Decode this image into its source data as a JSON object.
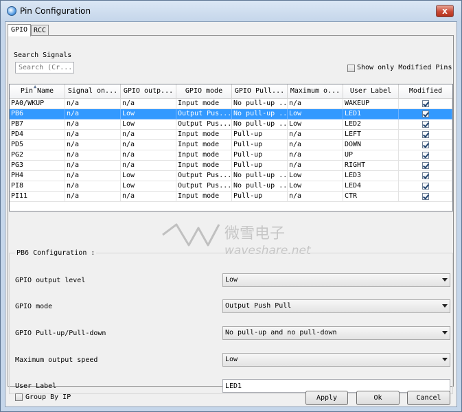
{
  "window": {
    "title": "Pin Configuration",
    "close_label": "x"
  },
  "tabs": [
    {
      "label": "GPIO",
      "active": true
    },
    {
      "label": "RCC",
      "active": false
    }
  ],
  "search": {
    "label": "Search Signals",
    "placeholder": "Search (Cr..."
  },
  "show_modified": {
    "label": "Show only Modified Pins",
    "checked": false
  },
  "table": {
    "columns": [
      "Pin Name",
      "Signal on...",
      "GPIO outp...",
      "GPIO mode",
      "GPIO Pull...",
      "Maximum o...",
      "User Label",
      "Modified"
    ],
    "rows": [
      {
        "cells": [
          "PA0/WKUP",
          "n/a",
          "n/a",
          "Input mode",
          "No pull-up ...",
          "n/a",
          "WAKEUP"
        ],
        "modified": true,
        "selected": false
      },
      {
        "cells": [
          "PB6",
          "n/a",
          "Low",
          "Output Pus...",
          "No pull-up ...",
          "Low",
          "LED1"
        ],
        "modified": true,
        "selected": true
      },
      {
        "cells": [
          "PB7",
          "n/a",
          "Low",
          "Output Pus...",
          "No pull-up ...",
          "Low",
          "LED2"
        ],
        "modified": true,
        "selected": false
      },
      {
        "cells": [
          "PD4",
          "n/a",
          "n/a",
          "Input mode",
          "Pull-up",
          "n/a",
          "LEFT"
        ],
        "modified": true,
        "selected": false
      },
      {
        "cells": [
          "PD5",
          "n/a",
          "n/a",
          "Input mode",
          "Pull-up",
          "n/a",
          "DOWN"
        ],
        "modified": true,
        "selected": false
      },
      {
        "cells": [
          "PG2",
          "n/a",
          "n/a",
          "Input mode",
          "Pull-up",
          "n/a",
          "UP"
        ],
        "modified": true,
        "selected": false
      },
      {
        "cells": [
          "PG3",
          "n/a",
          "n/a",
          "Input mode",
          "Pull-up",
          "n/a",
          "RIGHT"
        ],
        "modified": true,
        "selected": false
      },
      {
        "cells": [
          "PH4",
          "n/a",
          "Low",
          "Output Pus...",
          "No pull-up ...",
          "Low",
          "LED3"
        ],
        "modified": true,
        "selected": false
      },
      {
        "cells": [
          "PI8",
          "n/a",
          "Low",
          "Output Pus...",
          "No pull-up ...",
          "Low",
          "LED4"
        ],
        "modified": true,
        "selected": false
      },
      {
        "cells": [
          "PI11",
          "n/a",
          "n/a",
          "Input mode",
          "Pull-up",
          "n/a",
          "CTR"
        ],
        "modified": true,
        "selected": false
      }
    ]
  },
  "config": {
    "title": "PB6 Configuration :",
    "fields": [
      {
        "label": "GPIO output level",
        "value": "Low",
        "type": "select"
      },
      {
        "label": "GPIO mode",
        "value": "Output Push Pull",
        "type": "select"
      },
      {
        "label": "GPIO Pull-up/Pull-down",
        "value": "No pull-up and no pull-down",
        "type": "select"
      },
      {
        "label": "Maximum output speed",
        "value": "Low",
        "type": "select"
      },
      {
        "label": "User Label",
        "value": "LED1",
        "type": "text"
      }
    ]
  },
  "group_by_ip": {
    "label": "Group By IP",
    "checked": false
  },
  "buttons": {
    "apply": "Apply",
    "ok": "Ok",
    "cancel": "Cancel"
  },
  "watermark": {
    "brand_cn": "微雪电子",
    "brand_en": "waveshare.net"
  },
  "colors": {
    "selection": "#3399ff",
    "close": "#c94a36",
    "frame": "#c5d6ea"
  }
}
